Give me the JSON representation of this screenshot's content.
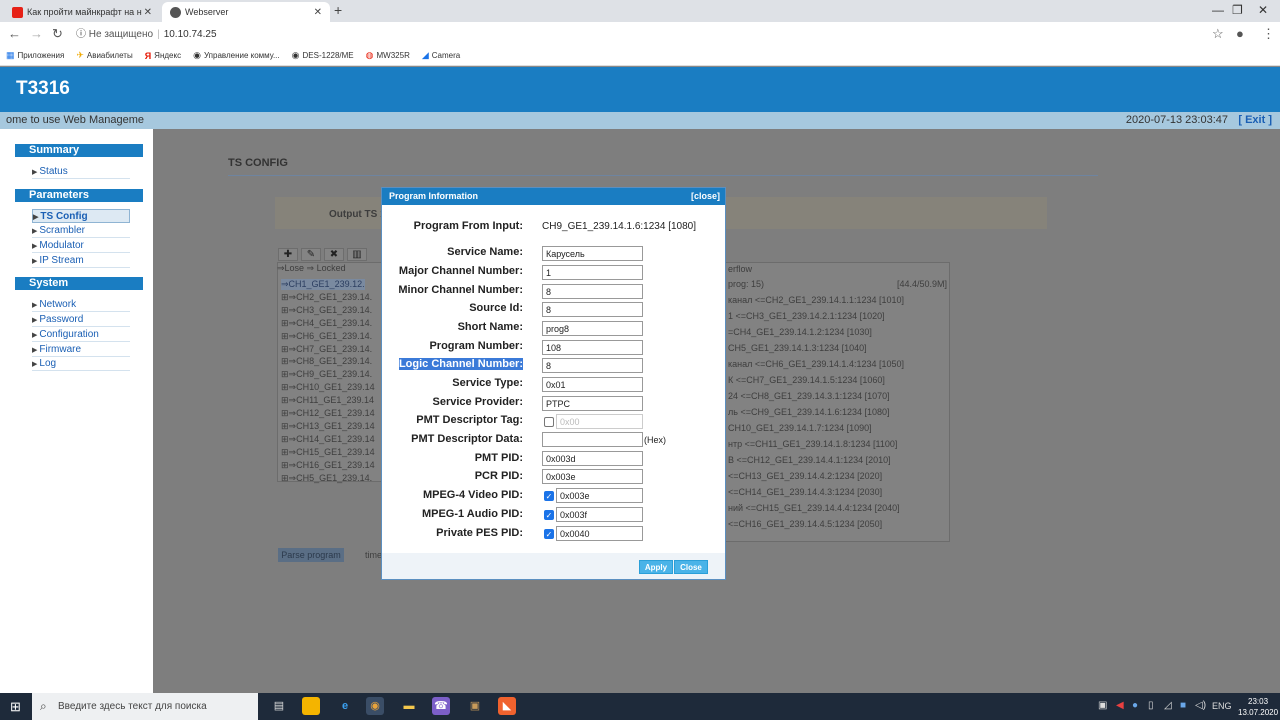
{
  "browser": {
    "tabs": [
      {
        "title": "Как пройти майнкрафт на н",
        "active": false
      },
      {
        "title": "Webserver",
        "active": true
      }
    ],
    "address": {
      "security": "Не защищено",
      "url": "10.10.74.25"
    },
    "bookmarks": [
      "Приложения",
      "Авиабилеты",
      "Яндекс",
      "Управление комму...",
      "DES-1228/ME",
      "MW325R",
      "Camera"
    ]
  },
  "app": {
    "title": "T3316",
    "welcome": "ome to use Web Manageme",
    "datetime": "2020-07-13 23:03:47",
    "exit_label": "[ Exit ]"
  },
  "sidebar": {
    "summary": {
      "title": "Summary",
      "items": [
        "Status"
      ]
    },
    "parameters": {
      "title": "Parameters",
      "items": [
        "TS Config",
        "Scrambler",
        "Modulator",
        "IP Stream"
      ]
    },
    "system": {
      "title": "System",
      "items": [
        "Network",
        "Password",
        "Configuration",
        "Firmware",
        "Log"
      ]
    }
  },
  "page": {
    "title": "TS CONFIG",
    "output_label": "Output TS 1",
    "legend": "⇒Lose  ⇒ Locked",
    "input_channels": [
      "⇒CH1_GE1_239.12.",
      "⊞⇒CH2_GE1_239.14.",
      "⊞⇒CH3_GE1_239.14.",
      "⊞⇒CH4_GE1_239.14.",
      "⊞⇒CH6_GE1_239.14.",
      "⊞⇒CH7_GE1_239.14.",
      "⊞⇒CH8_GE1_239.14.",
      "⊞⇒CH9_GE1_239.14.",
      "⊞⇒CH10_GE1_239.14",
      "⊞⇒CH11_GE1_239.14",
      "⊞⇒CH12_GE1_239.14",
      "⊞⇒CH13_GE1_239.14",
      "⊞⇒CH14_GE1_239.14",
      "⊞⇒CH15_GE1_239.14",
      "⊞⇒CH16_GE1_239.14",
      "⊞⇒CH5_GE1_239.14."
    ],
    "output_header": "erflow",
    "output_summary_left": "prog: 15)",
    "output_summary_right": "[44.4/50.9M]",
    "output_programs": [
      "канал <=CH2_GE1_239.14.1.1:1234 [1010]",
      "1 <=CH3_GE1_239.14.2.1:1234 [1020]",
      "=CH4_GE1_239.14.1.2:1234 [1030]",
      "CH5_GE1_239.14.1.3:1234 [1040]",
      "канал <=CH6_GE1_239.14.1.4:1234 [1050]",
      "К <=CH7_GE1_239.14.1.5:1234 [1060]",
      "24 <=CH8_GE1_239.14.3.1:1234 [1070]",
      "ль <=CH9_GE1_239.14.1.6:1234 [1080]",
      "CH10_GE1_239.14.1.7:1234 [1090]",
      "нтр <=CH11_GE1_239.14.1.8:1234 [1100]",
      "В <=CH12_GE1_239.14.4.1:1234 [2010]",
      "<=CH13_GE1_239.14.4.2:1234 [2020]",
      "<=CH14_GE1_239.14.4.3:1234 [2030]",
      "ний <=CH15_GE1_239.14.4.4:1234 [2040]",
      "<=CH16_GE1_239.14.4.5:1234 [2050]"
    ],
    "parse_button": "Parse program",
    "time_label": "time"
  },
  "modal": {
    "title": "Program Information",
    "close_link": "[close]",
    "program_from_input_label": "Program From Input:",
    "program_from_input_value": "CH9_GE1_239.14.1.6:1234 [1080]",
    "fields": {
      "service_name": {
        "label": "Service Name:",
        "value": "Карусель"
      },
      "major_channel": {
        "label": "Major Channel Number:",
        "value": "1"
      },
      "minor_channel": {
        "label": "Minor Channel Number:",
        "value": "8"
      },
      "source_id": {
        "label": "Source Id:",
        "value": "8"
      },
      "short_name": {
        "label": "Short Name:",
        "value": "prog8"
      },
      "program_number": {
        "label": "Program Number:",
        "value": "108"
      },
      "logic_channel": {
        "label": "Logic Channel Number:",
        "value": "8"
      },
      "service_type": {
        "label": "Service Type:",
        "value": "0x01"
      },
      "service_provider": {
        "label": "Service Provider:",
        "value": "PTPC"
      },
      "pmt_descriptor_tag": {
        "label": "PMT Descriptor Tag:",
        "value": "0x00",
        "checked": false
      },
      "pmt_descriptor_data": {
        "label": "PMT Descriptor Data:",
        "value": "",
        "suffix": "(Hex)"
      },
      "pmt_pid": {
        "label": "PMT PID:",
        "value": "0x003d"
      },
      "pcr_pid": {
        "label": "PCR PID:",
        "value": "0x003e"
      },
      "mpeg4_video_pid": {
        "label": "MPEG-4 Video PID:",
        "value": "0x003e",
        "checked": true
      },
      "mpeg1_audio_pid": {
        "label": "MPEG-1 Audio PID:",
        "value": "0x003f",
        "checked": true
      },
      "private_pes_pid": {
        "label": "Private PES PID:",
        "value": "0x0040",
        "checked": true
      }
    },
    "apply_label": "Apply",
    "close_label": "Close"
  },
  "taskbar": {
    "search_placeholder": "Введите здесь текст для поиска",
    "lang": "ENG",
    "time": "23:03",
    "date": "13.07.2020"
  },
  "colors": {
    "brand_blue": "#1a7dc2",
    "info_bar": "#a6c8de",
    "button_blue": "#4ab3e8"
  }
}
